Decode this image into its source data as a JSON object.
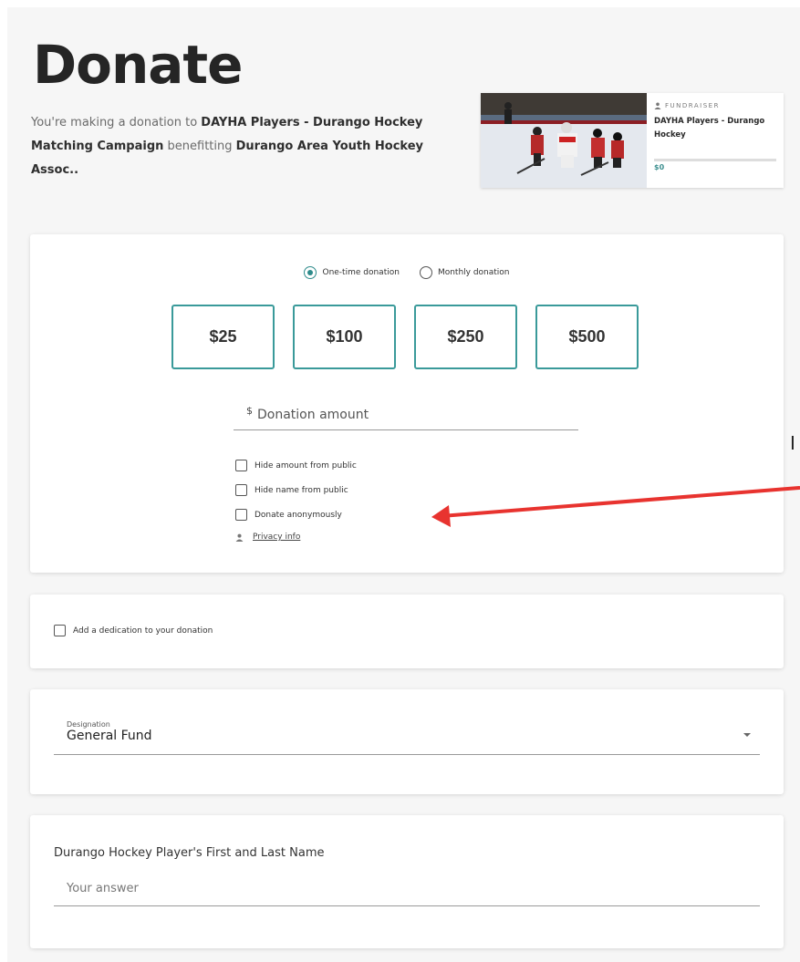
{
  "header": {
    "title": "Donate",
    "intro_prefix": "You're making a donation to ",
    "campaign": "DAYHA Players - Durango Hockey Matching Campaign",
    "intro_mid": " benefitting ",
    "organization": "Durango Area Youth Hockey Assoc.."
  },
  "fundraiser_card": {
    "tag": "FUNDRAISER",
    "name": "DAYHA Players - Durango Hockey",
    "amount": "$0"
  },
  "frequency": {
    "one_time": "One-time donation",
    "monthly": "Monthly donation",
    "selected": "one_time"
  },
  "amount_options": [
    "$25",
    "$100",
    "$250",
    "$500"
  ],
  "donation_amount": {
    "currency": "$",
    "placeholder": "Donation amount"
  },
  "privacy_options": {
    "hide_amount": "Hide amount from public",
    "hide_name": "Hide name from public",
    "anonymous": "Donate anonymously",
    "privacy_link": "Privacy info"
  },
  "dedication": {
    "label": "Add a dedication to your donation"
  },
  "designation": {
    "label": "Designation",
    "value": "General Fund"
  },
  "question": {
    "label": "Durango Hockey Player's First and Last Name",
    "placeholder": "Your answer"
  },
  "annotation": {
    "text": "I",
    "arrow_color": "#e8332f"
  },
  "colors": {
    "accent": "#3a9a9a",
    "title": "#252525"
  }
}
